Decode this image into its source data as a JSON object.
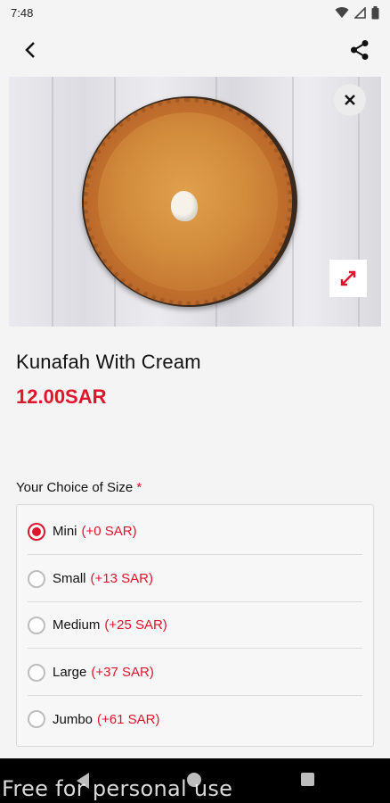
{
  "status_bar": {
    "time": "7:48"
  },
  "product": {
    "name": "Kunafah With Cream",
    "price": "12.00SAR"
  },
  "size_choice": {
    "label": "Your Choice of Size",
    "required_mark": "*",
    "selected": "Mini",
    "options": [
      {
        "name": "Mini",
        "price": "(+0 SAR)"
      },
      {
        "name": "Small",
        "price": "(+13 SAR)"
      },
      {
        "name": "Medium",
        "price": "(+25 SAR)"
      },
      {
        "name": "Large",
        "price": "(+37 SAR)"
      },
      {
        "name": "Jumbo",
        "price": "(+61 SAR)"
      }
    ]
  },
  "watermark": "Free for personal use",
  "icons": {
    "back": "back-arrow-icon",
    "share": "share-icon",
    "close": "close-icon",
    "expand": "expand-icon",
    "wifi": "wifi-icon",
    "signal": "signal-icon",
    "battery": "battery-icon"
  },
  "colors": {
    "accent": "#e0142b",
    "nav_bar": "#000000"
  }
}
